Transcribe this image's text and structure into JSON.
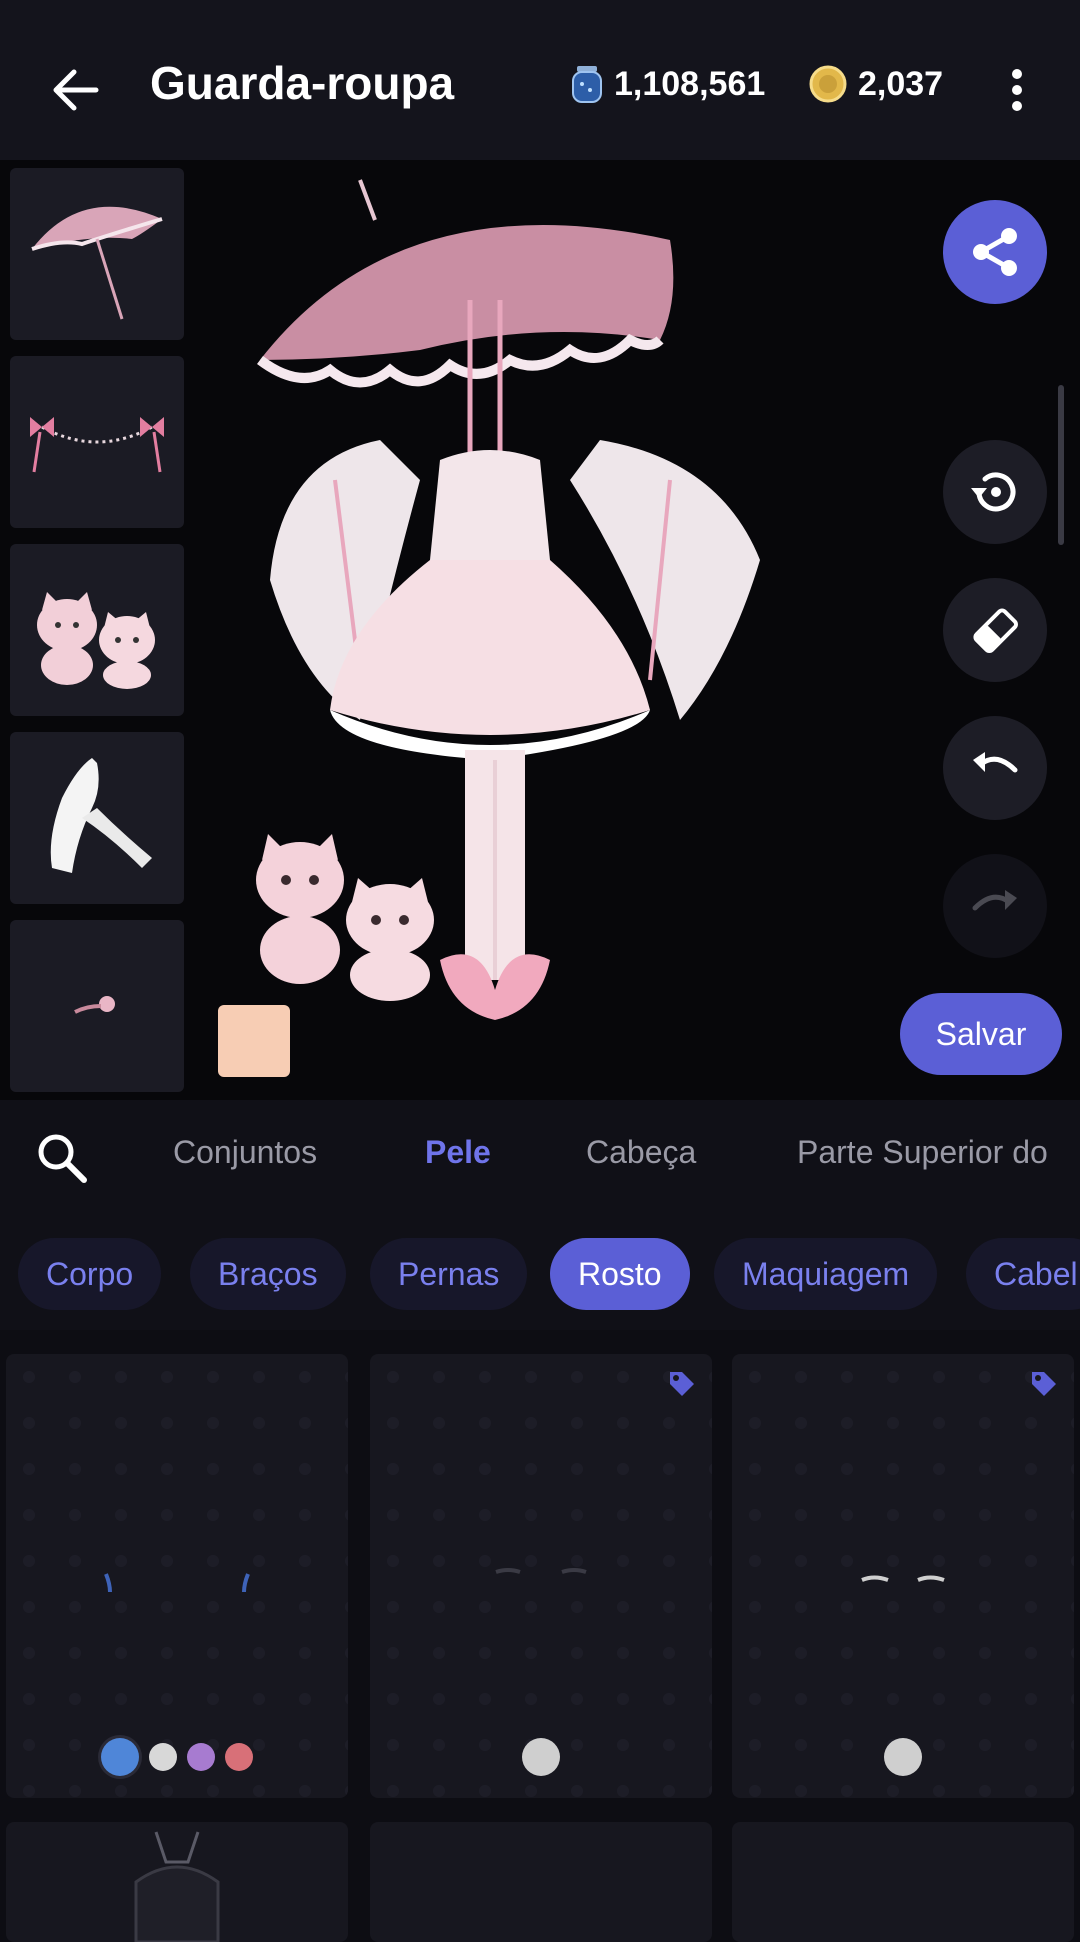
{
  "header": {
    "title": "Guarda-roupa",
    "gems": "1,108,561",
    "coins": "2,037"
  },
  "actions": {
    "save_label": "Salvar"
  },
  "equipped_items": [
    {
      "name": "umbrella"
    },
    {
      "name": "bow-garland"
    },
    {
      "name": "kittens"
    },
    {
      "name": "gloves"
    },
    {
      "name": "flower"
    }
  ],
  "categories": [
    {
      "label": "Conjuntos",
      "active": false
    },
    {
      "label": "Pele",
      "active": true
    },
    {
      "label": "Cabeça",
      "active": false
    },
    {
      "label": "Parte Superior do",
      "active": false
    }
  ],
  "subcategories": [
    {
      "label": "Corpo",
      "active": false
    },
    {
      "label": "Braços",
      "active": false
    },
    {
      "label": "Pernas",
      "active": false
    },
    {
      "label": "Rosto",
      "active": true
    },
    {
      "label": "Maquiagem",
      "active": false
    },
    {
      "label": "Cabel",
      "active": false
    }
  ],
  "items": [
    {
      "tagged": false,
      "colors": [
        "#4f86d8",
        "#d8d8d8",
        "#a77bd0",
        "#d87078"
      ],
      "selected_color": 0
    },
    {
      "tagged": true,
      "colors": [
        "#cfcfcf"
      ],
      "selected_color": 0
    },
    {
      "tagged": true,
      "colors": [
        "#cfcfcf"
      ],
      "selected_color": 0
    }
  ],
  "colors": {
    "accent": "#5b5fd6",
    "accent_text": "#6f74ea",
    "skin": "#f7cdb4"
  }
}
